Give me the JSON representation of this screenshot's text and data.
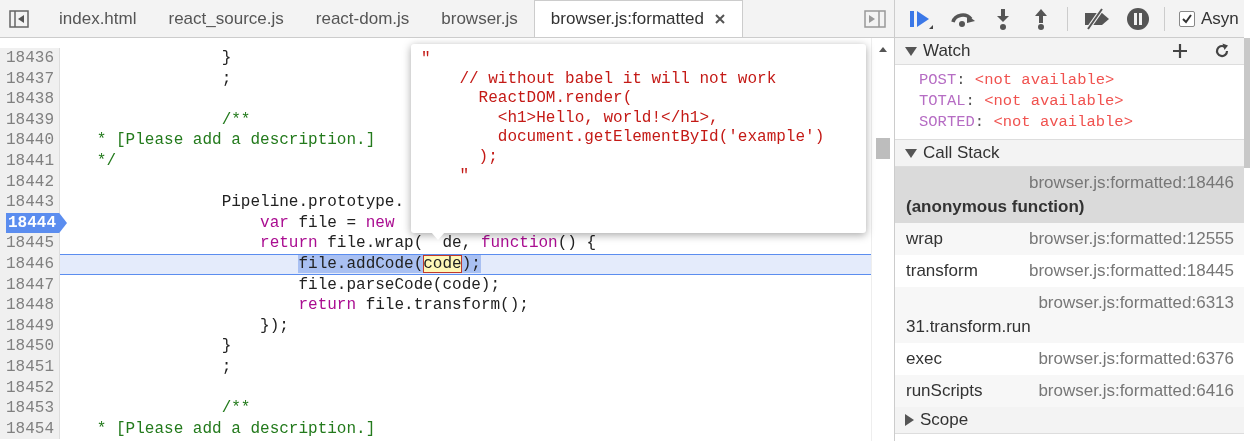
{
  "tabs": [
    {
      "label": "index.html",
      "selected": false,
      "closable": false
    },
    {
      "label": "react_source.js",
      "selected": false,
      "closable": false
    },
    {
      "label": "react-dom.js",
      "selected": false,
      "closable": false
    },
    {
      "label": "browser.js",
      "selected": false,
      "closable": false
    },
    {
      "label": "browser.js:formatted",
      "selected": true,
      "closable": true
    }
  ],
  "editor": {
    "lines": [
      {
        "number": "18436",
        "segments": [
          {
            "kind": "plain",
            "text": "                }"
          }
        ]
      },
      {
        "number": "18437",
        "segments": [
          {
            "kind": "plain",
            "text": "                ;"
          }
        ]
      },
      {
        "number": "18438"
      },
      {
        "number": "18439",
        "segments": [
          {
            "kind": "comment",
            "text": "                /**"
          }
        ]
      },
      {
        "number": "18440",
        "segments": [
          {
            "kind": "comment",
            "text": "   * [Please add a description.]"
          }
        ]
      },
      {
        "number": "18441",
        "segments": [
          {
            "kind": "comment",
            "text": "   */"
          }
        ]
      },
      {
        "number": "18442"
      },
      {
        "number": "18443",
        "segments": [
          {
            "kind": "plain",
            "text": "                Pipeline.prototype."
          }
        ]
      },
      {
        "number": "18444",
        "breakpoint": true,
        "segments": [
          {
            "kind": "keyword",
            "text": "                    var"
          },
          {
            "kind": "plain",
            "text": " file = "
          },
          {
            "kind": "keyword",
            "text": "new"
          }
        ]
      },
      {
        "number": "18445",
        "segments": [
          {
            "kind": "keyword",
            "text": "                    return"
          },
          {
            "kind": "plain",
            "text": " file.wrap("
          },
          {
            "kind": "plain",
            "text": "  de, "
          },
          {
            "kind": "keyword",
            "text": "function"
          },
          {
            "kind": "plain",
            "text": "() {"
          }
        ]
      },
      {
        "number": "18446",
        "paused": true,
        "segments": [
          {
            "kind": "selected",
            "text": "                        file.addCode("
          },
          {
            "kind": "hovered",
            "text": "code"
          },
          {
            "kind": "selected",
            "text": ");"
          }
        ]
      },
      {
        "number": "18447",
        "segments": [
          {
            "kind": "plain",
            "text": "                        file.parseCode(code);"
          }
        ]
      },
      {
        "number": "18448",
        "segments": [
          {
            "kind": "keyword",
            "text": "                        return"
          },
          {
            "kind": "plain",
            "text": " file.transform();"
          }
        ]
      },
      {
        "number": "18449",
        "segments": [
          {
            "kind": "plain",
            "text": "                    });"
          }
        ]
      },
      {
        "number": "18450",
        "segments": [
          {
            "kind": "plain",
            "text": "                }"
          }
        ]
      },
      {
        "number": "18451",
        "segments": [
          {
            "kind": "plain",
            "text": "                ;"
          }
        ]
      },
      {
        "number": "18452"
      },
      {
        "number": "18453",
        "segments": [
          {
            "kind": "comment",
            "text": "                /**"
          }
        ]
      },
      {
        "number": "18454",
        "segments": [
          {
            "kind": "comment",
            "text": "   * [Please add a description.]"
          }
        ]
      }
    ],
    "popover": {
      "lines": [
        "\"",
        "    // without babel it will not work",
        "      ReactDOM.render(",
        "        <h1>Hello, world!</h1>,",
        "        document.getElementById('example')",
        "      );",
        "    \""
      ]
    }
  },
  "debugger": {
    "async_checkbox": {
      "label": "Asyn",
      "checked": true
    },
    "watch": {
      "title": "Watch",
      "expanded": true,
      "items": [
        {
          "name": "POST",
          "separator": ":",
          "value": "<not available>"
        },
        {
          "name": "TOTAL",
          "separator": ":",
          "value": "<not available>"
        },
        {
          "name": "SORTED",
          "separator": ":",
          "value": "<not available>"
        }
      ]
    },
    "call_stack": {
      "title": "Call Stack",
      "expanded": true,
      "frames": [
        {
          "kind": "two_line",
          "name": "(anonymous function)",
          "location": "browser.js:formatted:18446",
          "selected": true
        },
        {
          "kind": "one_line",
          "name": "wrap",
          "location": "browser.js:formatted:12555",
          "selected": false
        },
        {
          "kind": "one_line",
          "name": "transform",
          "location": "browser.js:formatted:18445",
          "selected": false
        },
        {
          "kind": "two_line",
          "name": "31.transform.run",
          "location": "browser.js:formatted:6313",
          "selected": false
        },
        {
          "kind": "one_line",
          "name": "exec",
          "location": "browser.js:formatted:6376",
          "selected": false
        },
        {
          "kind": "one_line",
          "name": "runScripts",
          "location": "browser.js:formatted:6416",
          "selected": false
        }
      ]
    },
    "scope": {
      "title": "Scope",
      "expanded": false
    }
  }
}
